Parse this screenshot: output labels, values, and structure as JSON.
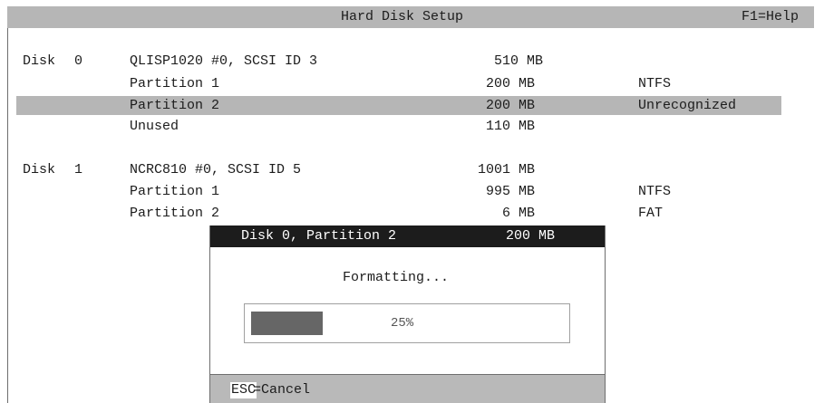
{
  "header": {
    "title": "Hard Disk Setup",
    "help": "F1=Help"
  },
  "disks": [
    {
      "label": "Disk",
      "number": "0",
      "name": "QLISP1020 #0, SCSI ID 3",
      "size": "510 MB",
      "partitions": [
        {
          "label": "Partition 1",
          "size": "200 MB",
          "fs": "NTFS"
        },
        {
          "label": "Partition 2",
          "size": "200 MB",
          "fs": "Unrecognized",
          "selected": true
        },
        {
          "label": "Unused",
          "size": "110 MB",
          "fs": ""
        }
      ]
    },
    {
      "label": "Disk",
      "number": "1",
      "name": "NCRC810 #0, SCSI ID 5",
      "size": "1001 MB",
      "partitions": [
        {
          "label": "Partition 1",
          "size": "995 MB",
          "fs": "NTFS"
        },
        {
          "label": "Partition 2",
          "size": "6 MB",
          "fs": "FAT"
        }
      ]
    }
  ],
  "dialog": {
    "title": "Disk 0, Partition 2",
    "size": "200 MB",
    "status": "Formatting...",
    "progress_value": 25,
    "progress_text": "25%",
    "footer_key": "ESC",
    "footer_action": "=Cancel"
  },
  "colors": {
    "header_bg": "#b6b6b6",
    "selection_bg": "#b6b6b6",
    "dialog_title_bg": "#1c1c1c",
    "progress_fill": "#666666"
  }
}
